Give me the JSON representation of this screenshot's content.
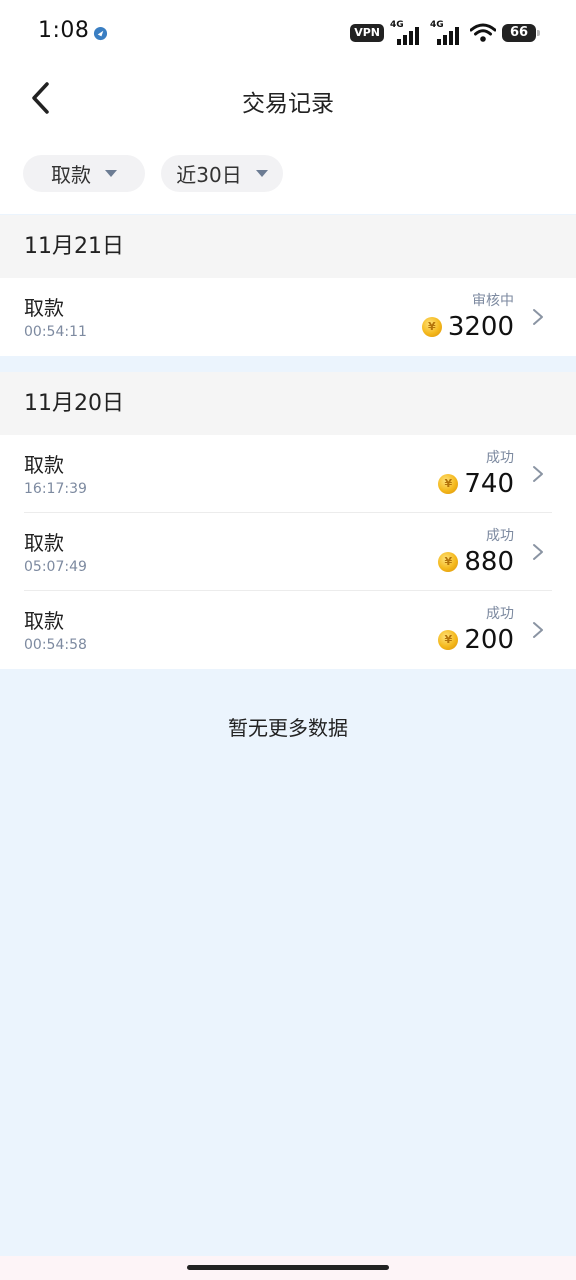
{
  "status_bar": {
    "time": "1:08",
    "vpn": "VPN",
    "network_1": "4G",
    "network_2": "4G",
    "battery": "66"
  },
  "header": {
    "title": "交易记录",
    "back_icon": "chevron-left-icon"
  },
  "filters": {
    "type_label": "取款",
    "range_label": "近30日",
    "dropdown_icon": "caret-down-icon"
  },
  "groups": [
    {
      "date": "11月21日",
      "rows": [
        {
          "title": "取款",
          "time": "00:54:11",
          "status": "审核中",
          "amount": "3200"
        }
      ]
    },
    {
      "date": "11月20日",
      "rows": [
        {
          "title": "取款",
          "time": "16:17:39",
          "status": "成功",
          "amount": "740"
        },
        {
          "title": "取款",
          "time": "05:07:49",
          "status": "成功",
          "amount": "880"
        },
        {
          "title": "取款",
          "time": "00:54:58",
          "status": "成功",
          "amount": "200"
        }
      ]
    }
  ],
  "coin_icon": "coin-icon",
  "coin_symbol": "¥",
  "footer": {
    "no_more": "暂无更多数据"
  },
  "colors": {
    "page_background": "#ebf4fd",
    "muted_text": "#7d8aa0",
    "coin": "#f4b81c"
  }
}
